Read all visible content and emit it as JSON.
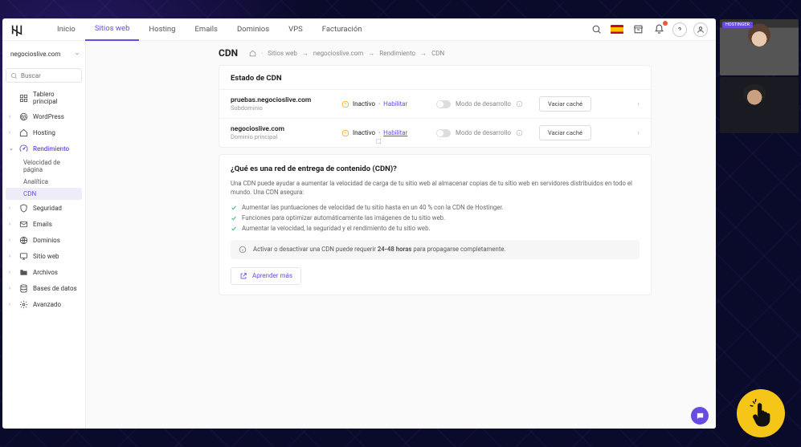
{
  "topnav": {
    "items": [
      "Inicio",
      "Sitios web",
      "Hosting",
      "Emails",
      "Dominios",
      "VPS",
      "Facturación"
    ],
    "active_index": 1
  },
  "sidebar": {
    "site": "negocioslive.com",
    "search_placeholder": "Buscar",
    "groups": [
      {
        "icon": "dashboard",
        "label": "Tablero principal",
        "expandable": false
      },
      {
        "icon": "wordpress",
        "label": "WordPress",
        "expandable": true
      },
      {
        "icon": "home",
        "label": "Hosting",
        "expandable": true
      },
      {
        "icon": "speed",
        "label": "Rendimiento",
        "active": true,
        "expanded": true,
        "children": [
          {
            "label": "Velocidad de página"
          },
          {
            "label": "Analítica"
          },
          {
            "label": "CDN",
            "active": true
          }
        ]
      },
      {
        "icon": "shield",
        "label": "Seguridad",
        "expandable": true
      },
      {
        "icon": "mail",
        "label": "Emails",
        "expandable": true
      },
      {
        "icon": "globe",
        "label": "Dominios",
        "expandable": true
      },
      {
        "icon": "monitor",
        "label": "Sitio web",
        "expandable": true
      },
      {
        "icon": "folder",
        "label": "Archivos",
        "expandable": true
      },
      {
        "icon": "database",
        "label": "Bases de datos",
        "expandable": true
      },
      {
        "icon": "gear",
        "label": "Avanzado",
        "expandable": true
      }
    ]
  },
  "breadcrumb": {
    "title": "CDN",
    "items": [
      "Sitios web",
      "negocioslive.com",
      "Rendimiento",
      "CDN"
    ]
  },
  "cdn_state": {
    "card_title": "Estado de CDN",
    "domains": [
      {
        "name": "pruebas.negocioslive.com",
        "sub": "Subdominio",
        "status": "Inactivo",
        "enable": "Habilitar",
        "dev_label": "Modo de desarrollo",
        "clear": "Vaciar caché"
      },
      {
        "name": "negocioslive.com",
        "sub": "Dominio principal",
        "status": "Inactivo",
        "enable": "Habilitar",
        "dev_label": "Modo de desarrollo",
        "clear": "Vaciar caché"
      }
    ]
  },
  "info": {
    "title": "¿Qué es una red de entrega de contenido (CDN)?",
    "desc": "Una CDN puede ayudar a aumentar la velocidad de carga de tu sitio web al almacenar copias de tu sitio web en servidores distribuidos en todo el mundo. Una CDN asegura:",
    "benefits": [
      "Aumentar las puntuaciones de velocidad de tu sitio hasta en un 40 % con la CDN de Hostinger.",
      "Funciones para optimizar automáticamente las imágenes de tu sitio web.",
      "Aumentar la velocidad, la seguridad y el rendimiento de tu sitio web."
    ],
    "note_pre": "Activar o desactivar una CDN puede requerir ",
    "note_bold": "24-48 horas",
    "note_post": " para propagarse completamente.",
    "learn": "Aprender más"
  },
  "webcam_tag": "HOSTINGER"
}
